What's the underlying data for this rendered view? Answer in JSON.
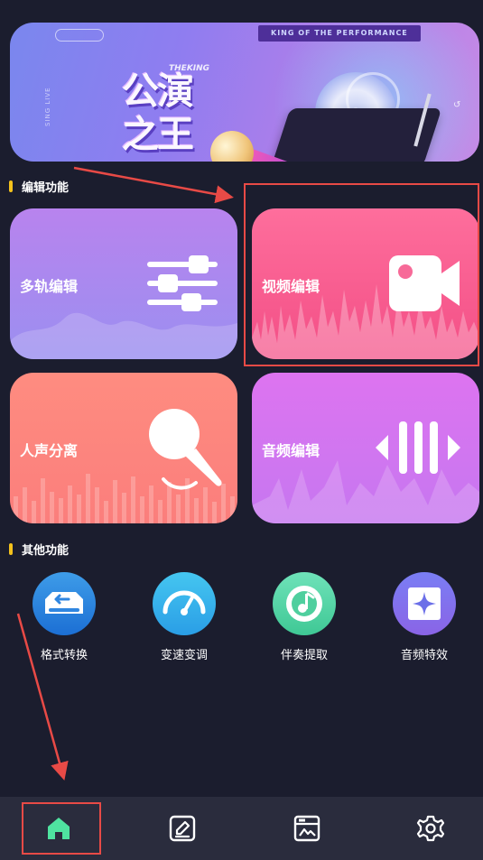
{
  "banner": {
    "main_title": "公演\n之王",
    "sub_title": "THEKING",
    "ribbon": "KING OF THE PERFORMANCE",
    "side_text": "SING LIVE"
  },
  "sections": {
    "edit_title": "编辑功能",
    "other_title": "其他功能"
  },
  "cards": [
    {
      "label": "多轨编辑",
      "icon": "sliders-icon"
    },
    {
      "label": "视频编辑",
      "icon": "video-camera-icon"
    },
    {
      "label": "人声分离",
      "icon": "microphone-icon"
    },
    {
      "label": "音频编辑",
      "icon": "audio-wave-icon"
    }
  ],
  "tools": [
    {
      "label": "格式转换",
      "icon": "format-convert-icon"
    },
    {
      "label": "变速变调",
      "icon": "speed-gauge-icon"
    },
    {
      "label": "伴奏提取",
      "icon": "music-note-icon"
    },
    {
      "label": "音频特效",
      "icon": "sparkle-effect-icon"
    }
  ],
  "nav": [
    {
      "name": "home",
      "icon": "home-icon",
      "active": true
    },
    {
      "name": "edit",
      "icon": "edit-icon",
      "active": false
    },
    {
      "name": "works",
      "icon": "media-icon",
      "active": false
    },
    {
      "name": "settings",
      "icon": "gear-icon",
      "active": false
    }
  ],
  "colors": {
    "background": "#1b1d2e",
    "accent_bar": "#f4c21c",
    "nav_active": "#4fe3a0",
    "annotation": "#e84a46"
  }
}
